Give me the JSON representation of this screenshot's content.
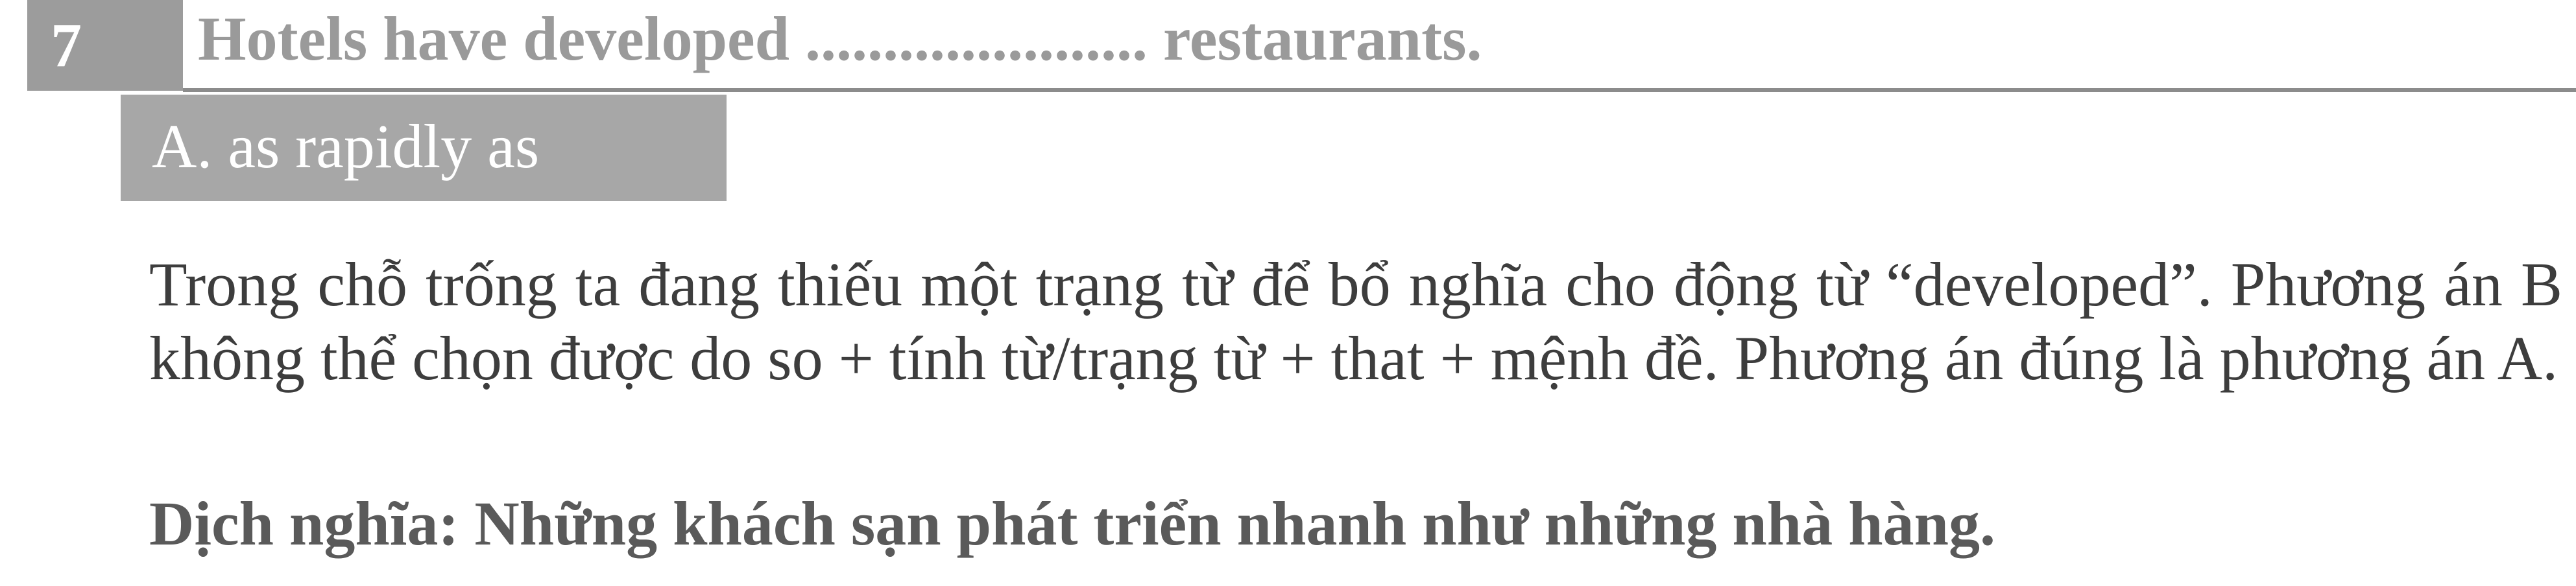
{
  "question": {
    "number": "7",
    "text": "Hotels have developed ...................... restaurants."
  },
  "answer": {
    "label": "A. as rapidly as"
  },
  "explanation": {
    "text": "Trong chỗ trống ta đang thiếu một trạng từ để bổ nghĩa cho động từ “developed”. Phương án B không thể chọn được do so + tính từ/trạng từ + that + mệnh đề. Phương án đúng là phương án A."
  },
  "translation": {
    "text": "Dịch nghĩa: Những khách sạn phát triển nhanh như những nhà hàng."
  }
}
